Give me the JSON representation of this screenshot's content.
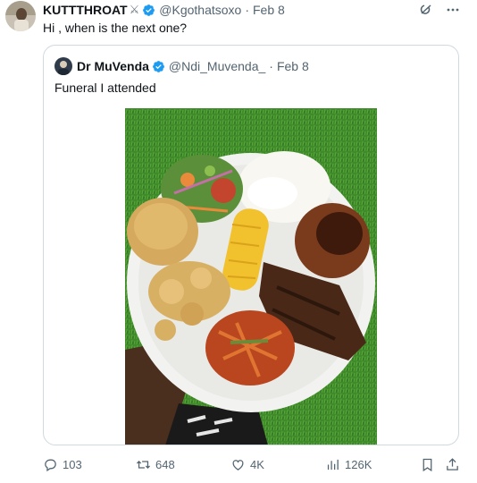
{
  "tweet": {
    "author": {
      "display_name": "KUTTTHROAT",
      "name_emoji": "⚔",
      "handle": "@Kgothatsoxo",
      "verified": true
    },
    "time": "Feb 8",
    "separator": "·",
    "text": "Hi , when is the next one?",
    "icons": {
      "grok": "grok-icon",
      "more": "more-icon"
    }
  },
  "quote": {
    "author": {
      "display_name": "Dr MuVenda",
      "handle": "@Ndi_Muvenda_",
      "verified": true
    },
    "time": "Feb 8",
    "separator": "·",
    "text": "Funeral I attended",
    "image_subject": "plate of food on grass"
  },
  "actions": {
    "replies": "103",
    "reposts": "648",
    "likes": "4K",
    "views": "126K",
    "icons": [
      "reply-icon",
      "repost-icon",
      "like-icon",
      "views-icon",
      "bookmark-icon",
      "share-icon"
    ]
  },
  "colors": {
    "verified": "#1d9bf0",
    "text": "#0f1419",
    "secondary": "#536471",
    "border": "#cfd9de"
  }
}
